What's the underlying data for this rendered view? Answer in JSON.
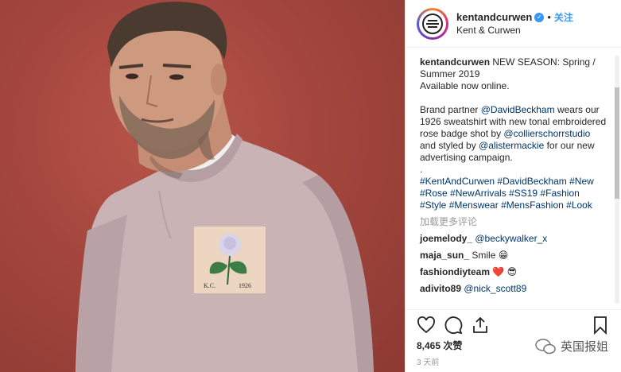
{
  "post": {
    "username": "kentandcurwen",
    "follow_label": "关注",
    "dot": "•",
    "verified_glyph": "✓",
    "location": "Kent & Curwen",
    "caption_user": "kentandcurwen",
    "caption_line1": " NEW SEASON: Spring / Summer 2019",
    "caption_line2": "Available now online.",
    "caption_p2_a": "Brand partner ",
    "mention_beckham": "@DavidBeckham",
    "caption_p2_b": " wears our 1926 sweatshirt with new tonal embroidered rose badge shot by ",
    "mention_studio": "@collierschorrstudio",
    "caption_p2_c": " and styled by ",
    "mention_stylist": "@alistermackie",
    "caption_p2_d": " for our new advertising campaign.",
    "caption_dot": ".",
    "hashtags": [
      "#KentAndCurwen",
      "#DavidBeckham",
      "#New",
      "#Rose",
      "#NewArrivals",
      "#SS19",
      "#Fashion",
      "#Style",
      "#Menswear",
      "#MensFashion",
      "#Look"
    ],
    "translate_label": "加载更多评论",
    "comments": [
      {
        "user": "joemelody_",
        "text": "@beckywalker_x",
        "is_mention": true
      },
      {
        "user": "maja_sun_",
        "text": "Smile 😁",
        "is_mention": false
      },
      {
        "user": "fashiondiyteam",
        "text": "❤️ 😎",
        "is_mention": false
      },
      {
        "user": "adivito89",
        "text": "@nick_scott89",
        "is_mention": true
      }
    ],
    "likes": "8,465 次赞",
    "time_ago": "3 天前"
  },
  "photo": {
    "badge_text_left": "K.C.",
    "badge_text_right": "1926"
  },
  "watermark": "英国报姐",
  "colors": {
    "link": "#003569",
    "follow": "#3897f0",
    "background_red": "#a4463e"
  }
}
